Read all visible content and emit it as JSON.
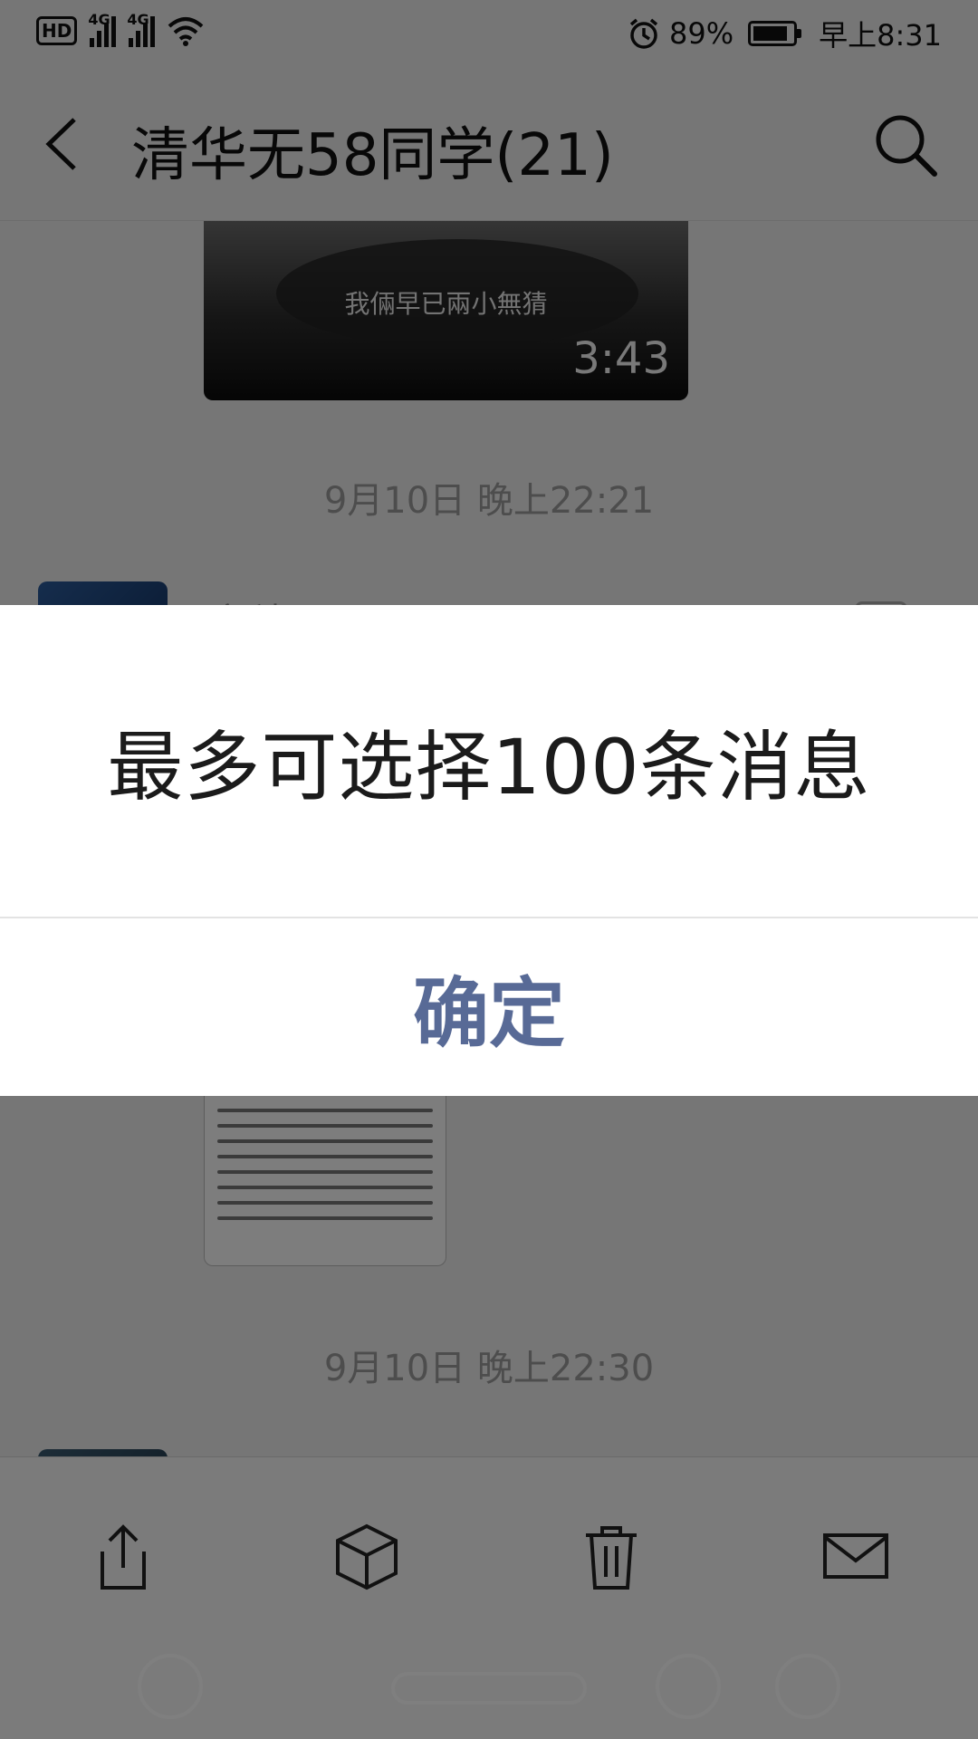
{
  "status_bar": {
    "hd_label": "HD",
    "sim1_network": "4G",
    "sim2_network": "4G",
    "battery_percent": "89%",
    "battery_level": 0.89,
    "time": "早上8:31"
  },
  "nav": {
    "title": "清华无58同学(21)"
  },
  "chat": {
    "video": {
      "subtitle": "我倆早已兩小無猜",
      "duration": "3:43"
    },
    "timestamp_1": "9月10日 晚上22:21",
    "sender_name_1": "文科",
    "timestamp_2": "9月10日 晚上22:30"
  },
  "dialog": {
    "message": "最多可选择100条消息",
    "confirm_label": "确定",
    "confirm_color": "#586a96"
  },
  "toolbar": {
    "icons": [
      "share-icon",
      "box-icon",
      "trash-icon",
      "mail-icon"
    ]
  },
  "system_nav": {
    "icons": [
      "ai-assistant-icon",
      "home-pill",
      "accessibility-icon",
      "eye-icon"
    ]
  }
}
